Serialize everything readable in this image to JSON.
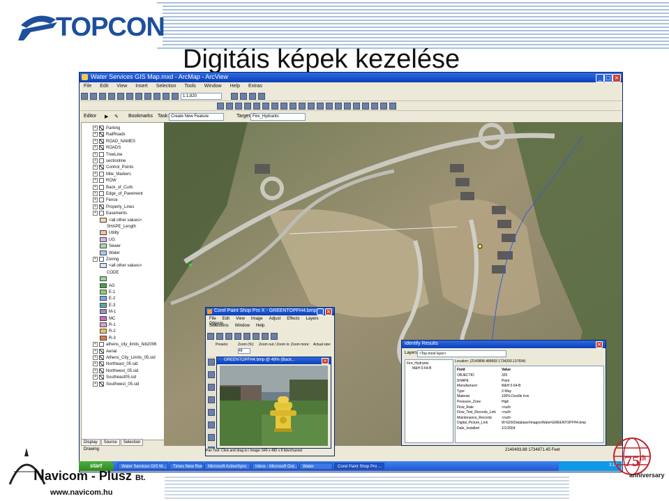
{
  "slide": {
    "brand": "TOPCON",
    "title": "Digitáis képek kezelése",
    "footer_company": "avicom - Plusz",
    "footer_company_initial": "N",
    "footer_company_suffix": "Bt.",
    "footer_url": "www.navicom.hu",
    "anniversary_number": "75",
    "anniversary_suffix": "th",
    "anniversary_word": "anniversary"
  },
  "arcmap": {
    "title": "Water Services GIS Map.mxd - ArcMap - ArcView",
    "menu": [
      "File",
      "Edit",
      "View",
      "Insert",
      "Selection",
      "Tools",
      "Window",
      "Help",
      "Extras"
    ],
    "scale": "1:1,820",
    "editor_label": "Editor",
    "task_label": "Task:",
    "task_value": "Create New Feature",
    "target_label": "Target:",
    "target_value": "Fire_Hydrants",
    "bookmarks_label": "Bookmarks",
    "drawing_label": "Drawing",
    "toc_tabs": [
      "Display",
      "Source",
      "Selection"
    ],
    "toc": [
      {
        "label": "Parking",
        "kind": "layer",
        "checked": true
      },
      {
        "label": "RailRoads",
        "kind": "layer",
        "checked": true
      },
      {
        "label": "ROAD_NAMES",
        "kind": "layer",
        "checked": true
      },
      {
        "label": "ROADS",
        "kind": "layer",
        "checked": true
      },
      {
        "label": "TreeLine",
        "kind": "layer",
        "checked": false
      },
      {
        "label": "sectionline",
        "kind": "layer",
        "checked": false
      },
      {
        "label": "Control_Points",
        "kind": "layer",
        "checked": true
      },
      {
        "label": "Mile_Markers",
        "kind": "layer",
        "checked": false
      },
      {
        "label": "ROW",
        "kind": "layer",
        "checked": false
      },
      {
        "label": "Back_of_Curb",
        "kind": "layer",
        "checked": false
      },
      {
        "label": "Edge_of_Pavement",
        "kind": "layer",
        "checked": false
      },
      {
        "label": "Fence",
        "kind": "layer",
        "checked": false
      },
      {
        "label": "Property_Lines",
        "kind": "layer",
        "checked": true
      },
      {
        "label": "Easements",
        "kind": "layer",
        "checked": false
      },
      {
        "label": "<all other values>",
        "kind": "legend",
        "color": "#f2d8a8"
      },
      {
        "label": "SHAPE_Length",
        "kind": "sub"
      },
      {
        "label": "Utility",
        "kind": "legend",
        "color": "#f5c09a"
      },
      {
        "label": "UG",
        "kind": "legend",
        "color": "#d7b4e6"
      },
      {
        "label": "Sewer",
        "kind": "legend",
        "color": "#a8d8a8"
      },
      {
        "label": "Water",
        "kind": "legend",
        "color": "#a8c8f0"
      },
      {
        "label": "Zoning",
        "kind": "layer",
        "checked": false
      },
      {
        "label": "<all other values>",
        "kind": "legend",
        "color": "#cde7f5"
      },
      {
        "label": "CODE",
        "kind": "sub"
      },
      {
        "label": "",
        "kind": "legend",
        "color": "#9bd39b"
      },
      {
        "label": "AG",
        "kind": "legend",
        "color": "#4aa04a"
      },
      {
        "label": "E-1",
        "kind": "legend",
        "color": "#8bd16a"
      },
      {
        "label": "E-2",
        "kind": "legend",
        "color": "#6fb0e0"
      },
      {
        "label": "E-3",
        "kind": "legend",
        "color": "#5ea6a6"
      },
      {
        "label": "M-1",
        "kind": "legend",
        "color": "#9a8fd0"
      },
      {
        "label": "MC",
        "kind": "legend",
        "color": "#c070c0"
      },
      {
        "label": "R-1",
        "kind": "legend",
        "color": "#e4a0c8"
      },
      {
        "label": "R-2",
        "kind": "legend",
        "color": "#f0c060"
      },
      {
        "label": "R-3",
        "kind": "legend",
        "color": "#e07a4a"
      },
      {
        "label": "athens_city_limits_feb2006",
        "kind": "layer",
        "checked": false
      },
      {
        "label": "Aerial",
        "kind": "group",
        "checked": true
      },
      {
        "label": "Athens_City_Limits_05.sid",
        "kind": "layer",
        "checked": true
      },
      {
        "label": "Northeast_05.sid",
        "kind": "layer",
        "checked": true
      },
      {
        "label": "Northwest_05.sid",
        "kind": "layer",
        "checked": true
      },
      {
        "label": "Southeast05.sid",
        "kind": "layer",
        "checked": true
      },
      {
        "label": "Southwest_05.sid",
        "kind": "layer",
        "checked": true
      }
    ]
  },
  "psp": {
    "title": "Corel Paint Shop Pro X - GREENTOPFH4.bmp",
    "menu": [
      "File",
      "Edit",
      "View",
      "Image",
      "Adjust",
      "Effects",
      "Layers",
      "Objects"
    ],
    "menu2": [
      "Selections",
      "Window",
      "Help"
    ],
    "options": [
      "Presets:",
      "Zoom (%):",
      "Zoom out / Zoom in:",
      "Zoom more:",
      "Actual size:"
    ],
    "zoom_value": "49",
    "image_title": "GREENTOPFH4.bmp @ 49% (Back...",
    "status": "Pan Tool: Click and drag to i    Image: 640 x 480 x 8 bits/channel"
  },
  "identify": {
    "title": "Identify Results",
    "layers_label": "Layers:",
    "layers_value": "<Top-most layer>",
    "tree_root": "Fire_Hydrants",
    "tree_child": "M&H 0-64-B",
    "location": "Location: (2140898.489683 1734200.137694)",
    "header_field": "Field",
    "header_value": "Value",
    "rows": [
      {
        "field": "OBJECTID",
        "value": "325"
      },
      {
        "field": "SHAPE",
        "value": "Point"
      },
      {
        "field": "Manufacturer",
        "value": "M&H 0-64-B"
      },
      {
        "field": "Type",
        "value": "3 Way"
      },
      {
        "field": "Material",
        "value": "100% Ductile Iron"
      },
      {
        "field": "Pressure_Zone",
        "value": "High"
      },
      {
        "field": "Flow_Rate",
        "value": "<null>"
      },
      {
        "field": "Flow_Test_Records_Link",
        "value": "<null>"
      },
      {
        "field": "Maintenance_Records",
        "value": "<null>"
      },
      {
        "field": "Digital_Picture_Link",
        "value": "W:\\GIS\\Database\\Images\\Water\\GREENTOPFH4.bmp"
      },
      {
        "field": "Date_Installed",
        "value": "1/1/2004"
      }
    ]
  },
  "statusbar": {
    "coords": "2140493.88  1734871.45 Feet"
  },
  "taskbar": {
    "start": "start",
    "tasks": [
      "Water Services GIS M...",
      "Times New Roman",
      "Microsoft ActiveSync",
      "Inbox - Microsoft Out...",
      "Water",
      "Corel Paint Shop Pro ..."
    ],
    "time": "3:16"
  },
  "colors": {
    "topcon_blue": "#1e4f9c",
    "xp_title_blue": "#0b3fb8",
    "xp_start_green": "#2e8a22",
    "anniversary_red": "#c0232c"
  }
}
